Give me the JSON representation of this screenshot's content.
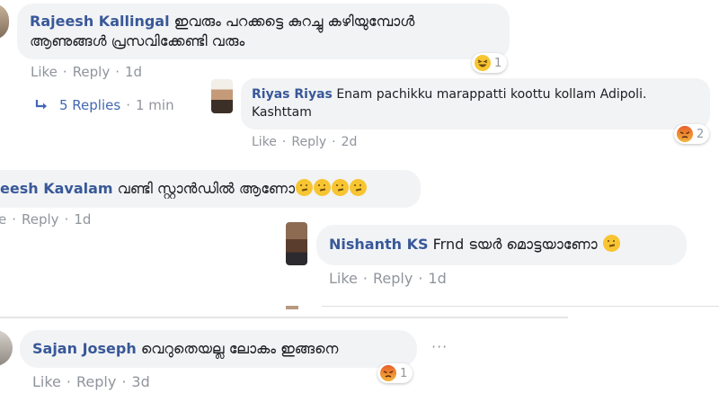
{
  "colors": {
    "name": "#385898",
    "meta": "#90949c",
    "bubble": "#f2f3f5",
    "reply_link": "#4267b2"
  },
  "actions": {
    "like": "Like",
    "reply": "Reply",
    "separator": "·"
  },
  "comments": [
    {
      "author": "Rajeesh Kallingal",
      "text_line1": "ഇവരും പറക്കട്ടെ കുറച്ചു കഴിയുമ്പോൾ",
      "text_line2": "ആണുങ്ങൾ പ്രസവിക്കേണ്ടി വരും",
      "time": "1d",
      "reaction": "haha",
      "reaction_count": "1"
    },
    {
      "author": "Riyas Riyas",
      "text_line1": "Enam pachikku marappatti koottu kollam Adipoli.",
      "text_line2": "Kashttam",
      "time": "2d",
      "reaction": "angry",
      "reaction_count": "2"
    },
    {
      "author": "eesh Kavalam",
      "text": "വണ്ടി സ്റ്റാൻഡിൽ ആണോ",
      "emoji": "thinking-face x4",
      "time": "1d",
      "like_partial": "e"
    },
    {
      "author": "Nishanth KS",
      "text": "Frnd ടയർ മൊട്ടയാണോ",
      "emoji": "thinking-face",
      "time": "1d"
    },
    {
      "author": "Sajan Joseph",
      "text": "വെറുതെയല്ല ലോകം ഇങ്ങനെ",
      "time": "3d",
      "reaction": "angry",
      "reaction_count": "1",
      "more_options": "···"
    }
  ],
  "replies_link": {
    "label": "5 Replies",
    "time": "1 min",
    "icon": "reply-arrow-icon"
  }
}
